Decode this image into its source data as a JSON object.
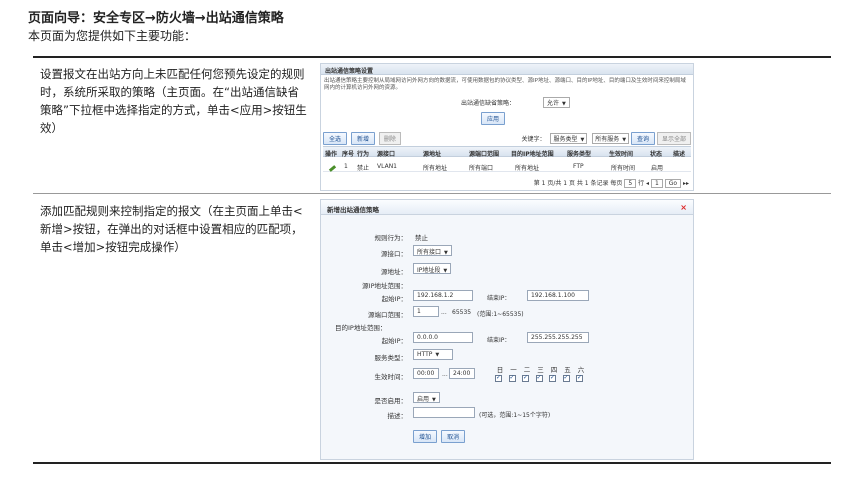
{
  "page": {
    "title": "页面向导：安全专区→防火墙→出站通信策略",
    "intro": "本页面为您提供如下主要功能："
  },
  "sections": [
    {
      "desc": "设置报文在出站方向上未匹配任何您预先设定的规则时，系统所采取的策略（主页面。在“出站通信缺省策略”下拉框中选择指定的方式，单击<应用>按钮生效）"
    },
    {
      "desc": "添加匹配规则来控制指定的报文（在主页面上单击<新增>按钮，在弹出的对话框中设置相应的匹配项，单击<增加>按钮完成操作）"
    }
  ],
  "shot1": {
    "header": "出站通信策略设置",
    "note": "出站通信策略主要控制从局域网访问外网方向的数据流，可使用数据包的协议类型、源IP地址、源端口、目的IP地址、目的端口及生效时间来控制局域网内的计算机访问外网的资源。",
    "default_label": "出站通信缺省策略：",
    "default_value": "允许",
    "apply": "应用",
    "btn_select_all": "全选",
    "btn_add": "新增",
    "btn_delete": "删除",
    "keyword_label": "关键字：",
    "keyword_field": "服务类型",
    "keyword_value": "所有服务",
    "btn_query": "查询",
    "btn_show_all": "显示全部",
    "columns": [
      "操作",
      "序号",
      "行为",
      "源接口",
      "源地址",
      "源端口范围",
      "目的IP地址范围",
      "服务类型",
      "生效时间",
      "状态",
      "描述"
    ],
    "row": [
      "1",
      "禁止",
      "VLAN1",
      "所有地址",
      "所有端口",
      "所有地址",
      "FTP",
      "所有时间",
      "启用"
    ],
    "pager_text": "第 1 页/共 1 页 共 1 条记录 每页",
    "pager_size": "5",
    "pager_unit": "行",
    "pager_page": "1",
    "pager_go": "Go"
  },
  "shot2": {
    "header": "新增出站通信策略",
    "close": "×",
    "action_label": "规则行为：",
    "action_value": "禁止",
    "src_if_label": "源接口：",
    "src_if_value": "所有接口",
    "src_addr_label": "源地址：",
    "src_addr_value": "IP地址段",
    "src_ip_range_label": "源IP地址范围：",
    "start_ip_label": "起始IP：",
    "src_start_ip": "192.168.1.2",
    "end_ip_label": "结束IP：",
    "src_end_ip": "192.168.1.100",
    "src_port_label": "源端口范围：",
    "src_port_from": "1",
    "src_port_sep": "...",
    "src_port_to": "65535",
    "src_port_hint": "(范围:1~65535)",
    "dst_ip_range_label": "目的IP地址范围：",
    "dst_start_ip": "0.0.0.0",
    "dst_end_ip": "255.255.255.255",
    "service_label": "服务类型：",
    "service_value": "HTTP",
    "time_label": "生效时间：",
    "time_from": "00:00",
    "time_sep": "...",
    "time_to": "24:00",
    "days": [
      "日",
      "一",
      "二",
      "三",
      "四",
      "五",
      "六"
    ],
    "enable_label": "是否启用：",
    "enable_value": "启用",
    "desc_label": "描述：",
    "desc_hint": "(可选，范围:1~15个字符)",
    "btn_add": "增加",
    "btn_cancel": "取消"
  }
}
